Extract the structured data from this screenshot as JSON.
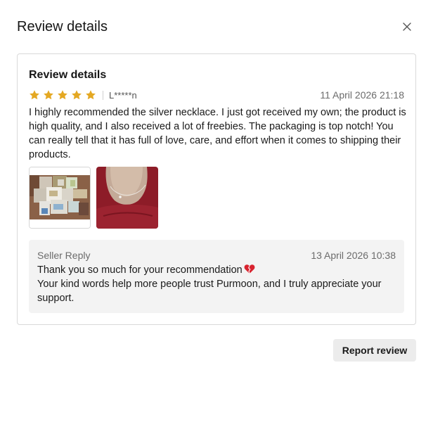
{
  "modal": {
    "title": "Review details",
    "close_icon": "close-icon"
  },
  "review": {
    "card_title": "Review details",
    "rating": 5,
    "rating_max": 5,
    "star_color": "#e4a823",
    "reviewer": "L*****n",
    "date": "11 April 2026 21:18",
    "text": "I highly recommended the silver necklace. I just got received my own; the product is high quality, and I also received a lot of freebies. The packaging is top notch! You can really tell that it has full of love, care, and effort when it comes to shipping their products.",
    "photos": [
      {
        "icon": "review-photo-package-image"
      },
      {
        "icon": "review-photo-necklace-image"
      }
    ]
  },
  "seller_reply": {
    "label": "Seller Reply",
    "date": "13 April 2026 10:38",
    "line1": "Thank you so much for your recommendation",
    "line2": "Your kind words help more people trust Purmoon, and I truly appreciate your support.",
    "emoji_icon": "broken-heart-icon"
  },
  "actions": {
    "report_label": "Report review"
  }
}
